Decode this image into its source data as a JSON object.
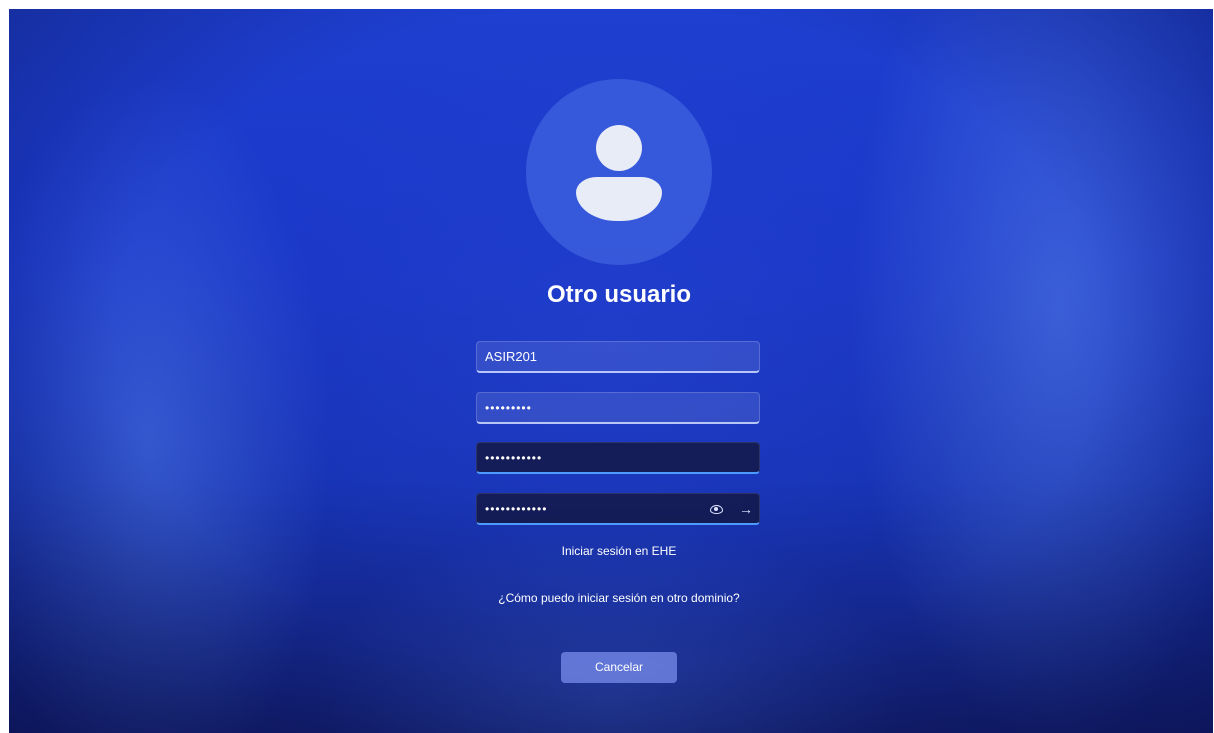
{
  "login": {
    "title": "Otro usuario",
    "fields": [
      {
        "value": "ASIR201"
      },
      {
        "value": "•••••••••"
      },
      {
        "value": "•••••••••••"
      },
      {
        "value": "••••••••••••"
      }
    ],
    "show_password_icon": "eye-icon",
    "submit_icon": "arrow-right-icon",
    "sign_in_domain_text": "Iniciar sesión en EHE",
    "other_domain_link": "¿Cómo puedo iniciar sesión en otro dominio?",
    "cancel_label": "Cancelar"
  },
  "colors": {
    "background_primary": "#1a37c8",
    "focus_accent": "#4c9bff",
    "avatar_fill": "#e8ecf6"
  }
}
